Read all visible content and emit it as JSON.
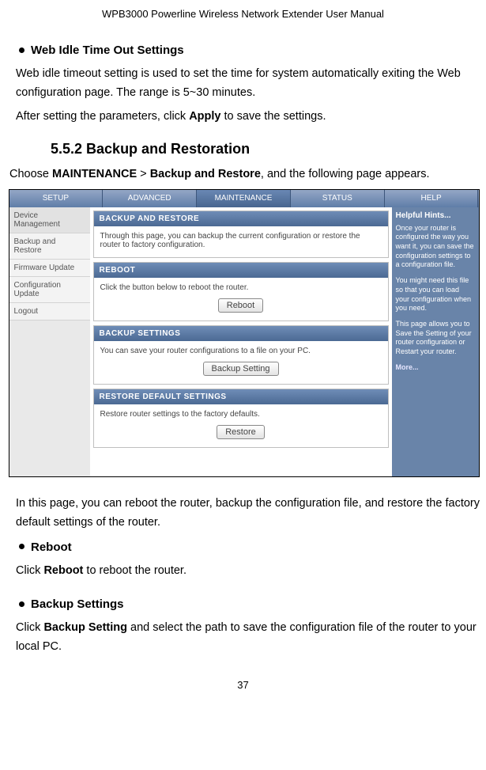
{
  "doc_header": "WPB3000 Powerline Wireless Network Extender User Manual",
  "sec_idle_title": "Web Idle Time Out Settings",
  "idle_p1": "Web idle timeout setting is used to set the time for system automatically exiting the Web configuration page. The range is 5~30 minutes.",
  "idle_p2_prefix": "After setting the parameters, click ",
  "idle_p2_bold": "Apply",
  "idle_p2_suffix": " to save the settings.",
  "sec_552": "5.5.2  Backup and Restoration",
  "choose_prefix": "Choose ",
  "choose_b1": "MAINTENANCE",
  "choose_mid": " > ",
  "choose_b2": "Backup and Restore",
  "choose_suffix": ", and the following page appears.",
  "router": {
    "tabs": {
      "setup": "SETUP",
      "advanced": "ADVANCED",
      "maintenance": "MAINTENANCE",
      "status": "STATUS",
      "help": "HELP"
    },
    "side": {
      "dev": "Device Management",
      "backup": "Backup and Restore",
      "fw": "Firmware Update",
      "conf": "Configuration Update",
      "logout": "Logout"
    },
    "panel_backup_title": "BACKUP AND RESTORE",
    "panel_backup_body": "Through this page, you can backup the current configuration or restore the router to factory configuration.",
    "panel_reboot_title": "REBOOT",
    "panel_reboot_body": "Click the button below to reboot the router.",
    "btn_reboot": "Reboot",
    "panel_bs_title": "BACKUP SETTINGS",
    "panel_bs_body": "You can save your router configurations to a file on your PC.",
    "btn_backup": "Backup Setting",
    "panel_restore_title": "RESTORE DEFAULT SETTINGS",
    "panel_restore_body": "Restore router settings to the factory defaults.",
    "btn_restore": "Restore",
    "hints_title": "Helpful Hints...",
    "hints_p1": "Once your router is configured the way you want it, you can save the configuration settings to a configuration file.",
    "hints_p2": "You might need this file so that you can load your configuration when you need.",
    "hints_p3": "This page allows you to Save the Setting of your router configuration or Restart your router.",
    "hints_more": "More..."
  },
  "after_img_p": "In this page, you can reboot the router, backup the configuration file, and restore the factory default settings of the router.",
  "sec_reboot_title": "Reboot",
  "reboot_p_prefix": "Click ",
  "reboot_p_bold": "Reboot",
  "reboot_p_suffix": " to reboot the router.",
  "sec_bs_title": "Backup Settings",
  "bs_p_prefix": "Click ",
  "bs_p_bold": "Backup Setting",
  "bs_p_suffix": " and select the path to save the configuration file of the router to your local PC.",
  "page_number": "37"
}
